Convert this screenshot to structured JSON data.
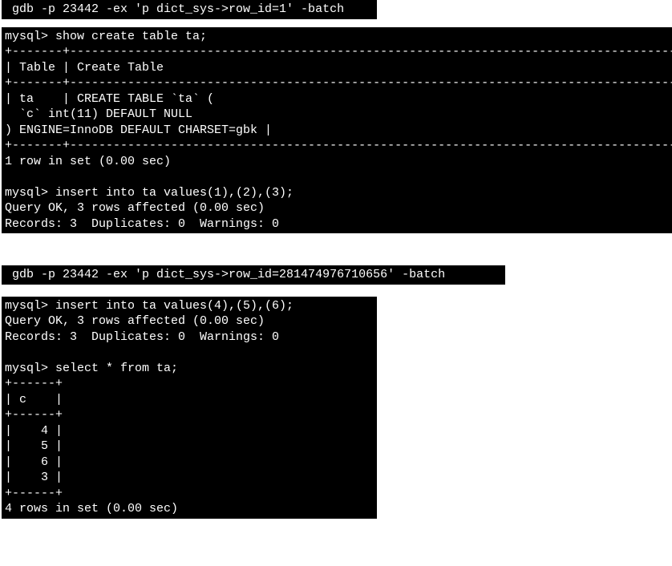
{
  "block1": {
    "line1": " gdb -p 23442 -ex 'p dict_sys->row_id=1' -batch"
  },
  "block2": {
    "l1": "mysql> show create table ta;",
    "l2": "+-------+------------------------------------------------------------------------------------+",
    "l3": "| Table | Create Table",
    "l4": "+-------+------------------------------------------------------------------------------------+",
    "l5": "| ta    | CREATE TABLE `ta` (",
    "l6": "  `c` int(11) DEFAULT NULL",
    "l7": ") ENGINE=InnoDB DEFAULT CHARSET=gbk |",
    "l8": "+-------+------------------------------------------------------------------------------------+",
    "l9": "1 row in set (0.00 sec)",
    "l10": "",
    "l11": "mysql> insert into ta values(1),(2),(3);",
    "l12": "Query OK, 3 rows affected (0.00 sec)",
    "l13": "Records: 3  Duplicates: 0  Warnings: 0"
  },
  "block3": {
    "line1": " gdb -p 23442 -ex 'p dict_sys->row_id=281474976710656' -batch"
  },
  "block4": {
    "l1": "mysql> insert into ta values(4),(5),(6);",
    "l2": "Query OK, 3 rows affected (0.00 sec)",
    "l3": "Records: 3  Duplicates: 0  Warnings: 0",
    "l4": "",
    "l5": "mysql> select * from ta;",
    "l6": "+------+",
    "l7": "| c    |",
    "l8": "+------+",
    "l9": "|    4 |",
    "l10": "|    5 |",
    "l11": "|    6 |",
    "l12": "|    3 |",
    "l13": "+------+",
    "l14": "4 rows in set (0.00 sec)"
  }
}
